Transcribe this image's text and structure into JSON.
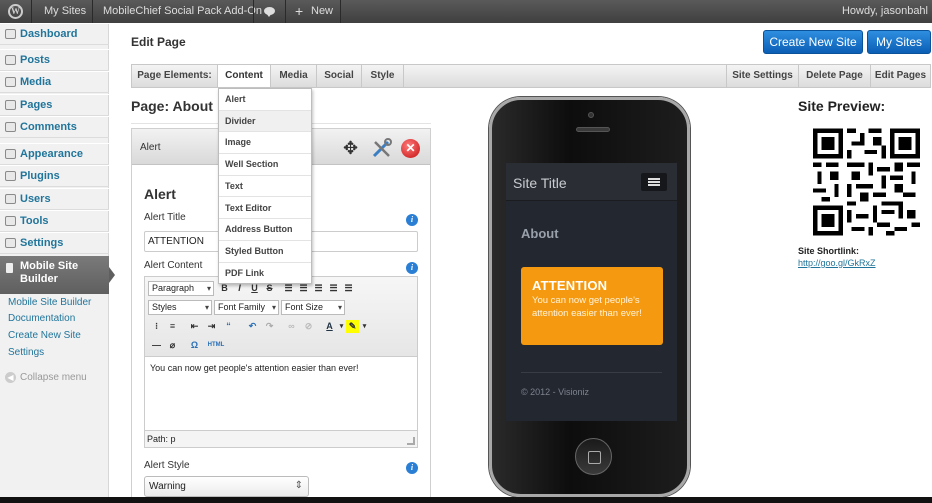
{
  "adminbar": {
    "wp_logo": "W",
    "my_sites": "My Sites",
    "site_name": "MobileChief Social Pack Add-On",
    "new_label": "New",
    "howdy": "Howdy, jasonbahl"
  },
  "sidebar": {
    "items": [
      {
        "label": "Dashboard"
      },
      {
        "label": "Posts"
      },
      {
        "label": "Media"
      },
      {
        "label": "Pages"
      },
      {
        "label": "Comments"
      },
      {
        "label": "Appearance"
      },
      {
        "label": "Plugins"
      },
      {
        "label": "Users"
      },
      {
        "label": "Tools"
      },
      {
        "label": "Settings"
      }
    ],
    "active": "Mobile Site Builder",
    "submenu": [
      "Mobile Site Builder",
      "Documentation",
      "Create New Site",
      "Settings"
    ],
    "collapse": "Collapse menu"
  },
  "header": {
    "title": "Edit Page",
    "create_new_site": "Create New Site",
    "my_sites": "My Sites"
  },
  "toolbar": {
    "page_elements": "Page Elements:",
    "tabs": [
      "Content",
      "Media",
      "Social",
      "Style"
    ],
    "right": [
      "Site Settings",
      "Delete Page",
      "Edit Pages"
    ]
  },
  "dropdown": {
    "items": [
      "Alert",
      "Divider",
      "Image",
      "Well Section",
      "Text",
      "Text Editor",
      "Address Button",
      "Styled Button",
      "PDF Link"
    ]
  },
  "page": {
    "heading": "Page: About"
  },
  "panel": {
    "header": "Alert",
    "heading": "Alert",
    "alert_title_label": "Alert Title",
    "alert_title_value": "ATTENTION",
    "alert_content_label": "Alert Content",
    "editor": {
      "format": "Paragraph",
      "styles": "Styles",
      "font_family": "Font Family",
      "font_size": "Font Size",
      "content": "You can now get people's attention easier than ever!",
      "path": "Path: p"
    },
    "alert_style_label": "Alert Style",
    "alert_style_value": "Warning"
  },
  "phone": {
    "site_title": "Site Title",
    "page_title": "About",
    "alert_title": "ATTENTION",
    "alert_body": "You can now get people's attention easier than ever!",
    "footer": "© 2012 - Visioniz"
  },
  "preview": {
    "title": "Site Preview:",
    "shortlink_label": "Site Shortlink:",
    "shortlink": "http://goo.gl/GkRxZ"
  },
  "colors": {
    "primary_blue": "#1570cf",
    "alert_orange": "#f59a10",
    "admin_bar": "#464646",
    "link": "#21759b"
  }
}
